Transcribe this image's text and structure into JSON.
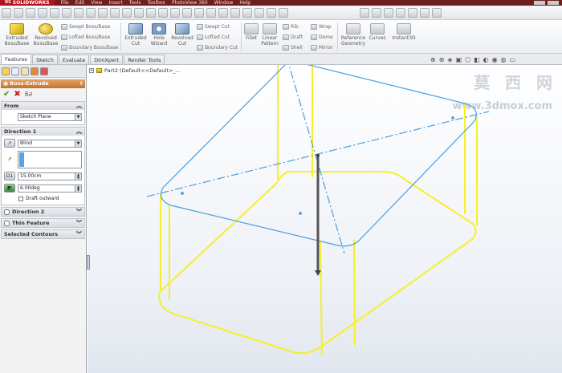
{
  "titlebar": {
    "brand": "SOLIDWORKS",
    "brand_prefix": "DS",
    "menus": [
      "File",
      "Edit",
      "View",
      "Insert",
      "Tools",
      "Toolbox",
      "PhotoView 360",
      "Window",
      "Help"
    ]
  },
  "command_manager": {
    "extruded_boss": "Extruded Boss/Base",
    "revolved_boss": "Revolved Boss/Base",
    "swept_boss": "Swept Boss/Base",
    "lofted_boss": "Lofted Boss/Base",
    "boundary_boss": "Boundary Boss/Base",
    "extruded_cut": "Extruded Cut",
    "hole_wizard": "Hole Wizard",
    "revolved_cut": "Revolved Cut",
    "swept_cut": "Swept Cut",
    "lofted_cut": "Lofted Cut",
    "boundary_cut": "Boundary Cut",
    "fillet": "Fillet",
    "linear_pattern": "Linear Pattern",
    "rib": "Rib",
    "draft": "Draft",
    "shell": "Shell",
    "wrap": "Wrap",
    "dome": "Dome",
    "mirror": "Mirror",
    "reference_geometry": "Reference Geometry",
    "curves": "Curves",
    "instant3d": "Instant3D"
  },
  "tabs": [
    "Features",
    "Sketch",
    "Evaluate",
    "DimXpert",
    "Render Tools"
  ],
  "active_tab": "Features",
  "property_manager": {
    "title": "Boss-Extrude",
    "help": "?",
    "ok": "✔",
    "cancel": "✖",
    "detail": "6∂",
    "from": {
      "label": "From",
      "value": "Sketch Plane"
    },
    "direction1": {
      "label": "Direction 1",
      "end_condition": "Blind",
      "depth": "15.00cm",
      "draft_angle": "6.00deg",
      "draft_outward": "Draft outward"
    },
    "direction2": "Direction 2",
    "thin_feature": "Thin Feature",
    "selected_contours": "Selected Contours"
  },
  "tree": {
    "part_label": "Part2  (Default<<Default>_..."
  },
  "watermark": {
    "chinese": "莫 西 网",
    "url": "www.3dmox.com"
  },
  "colors": {
    "sketch_blue": "#4a9ee0",
    "preview_yellow": "#f5f02a",
    "pm_header": "#c7722a",
    "titlebar": "#6f1d1d"
  }
}
